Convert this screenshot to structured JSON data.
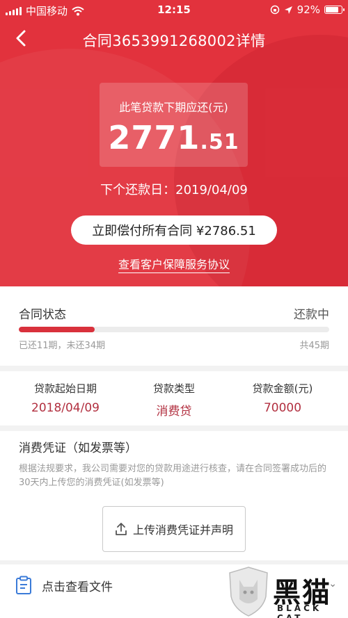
{
  "status_bar": {
    "carrier": "中国移动",
    "time": "12:15",
    "battery": "92%",
    "battery_level": 0.92
  },
  "nav": {
    "title": "合同3653991268002详情"
  },
  "repayment": {
    "label": "此笔贷款下期应还(元)",
    "amount_int": "2771",
    "amount_dec": ".51",
    "next_date_text": "下个还款日：2019/04/09",
    "pay_all_label": "立即偿付所有合同 ¥2786.51",
    "agreement_link": "查看客户保障服务协议"
  },
  "contract_status": {
    "title": "合同状态",
    "value": "还款中",
    "progress_fraction": 0.244,
    "summary": "已还11期，未还34期",
    "total": "共45期"
  },
  "loan_info": [
    {
      "label": "贷款起始日期",
      "value": "2018/04/09"
    },
    {
      "label": "贷款类型",
      "value": "消费贷"
    },
    {
      "label": "贷款金额(元)",
      "value": "70000"
    }
  ],
  "voucher": {
    "title": "消费凭证（如发票等）",
    "description": "根据法规要求，我公司需要对您的贷款用途进行核查，请在合同签署成功后的30天内上传您的消费凭证(如发票等)",
    "upload_label": "上传消费凭证并声明"
  },
  "files": {
    "label": "点击查看文件"
  },
  "watermark": {
    "title": "黑猫",
    "subtitle": "BLACK CAT"
  },
  "colors": {
    "brand_red": "#e2323d",
    "value_red": "#b23040"
  }
}
